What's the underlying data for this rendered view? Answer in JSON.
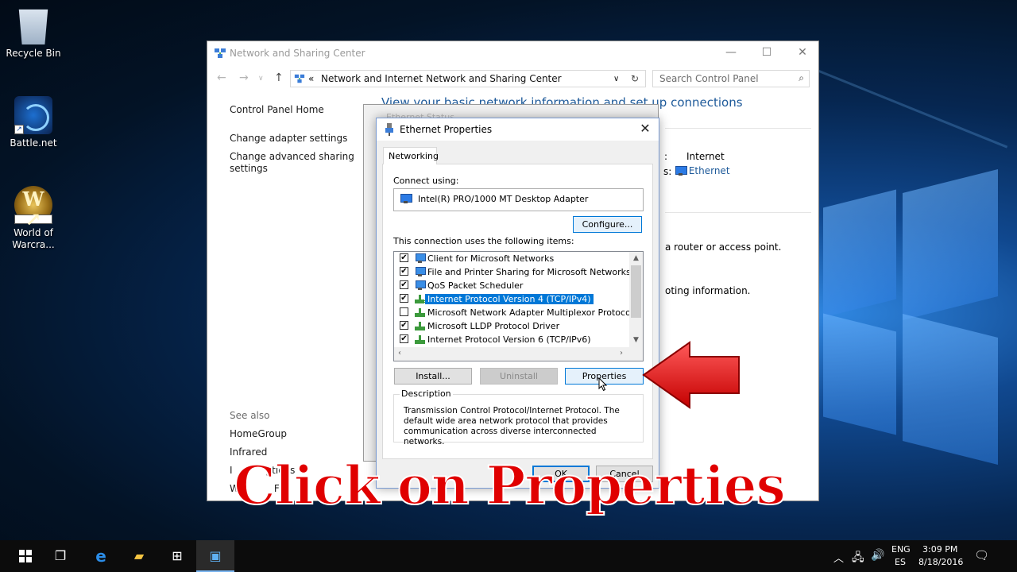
{
  "desktop": {
    "icons": [
      {
        "label": "Recycle Bin",
        "icon": "recycle-bin-icon"
      },
      {
        "label": "Battle.net",
        "icon": "battlenet-icon"
      },
      {
        "label": "World of Warcra...",
        "icon": "world-of-warcraft-icon",
        "line1": "World of",
        "line2": "Warcra..."
      }
    ]
  },
  "nsc": {
    "title": "Network and Sharing Center",
    "breadcrumb": {
      "prefix": "«",
      "items": [
        "Network and Internet",
        "Network and Sharing Center"
      ]
    },
    "search_placeholder": "Search Control Panel",
    "heading": "View your basic network information and set up connections",
    "left_links": {
      "home": "Control Panel Home",
      "adapter": "Change adapter settings",
      "advanced_line1": "Change advanced sharing",
      "advanced_line2": "settings",
      "see_also": "See also",
      "homegroup": "HomeGroup",
      "infrared": "Infrared",
      "internet_options_partial": "I",
      "internet_options_end": "ptions",
      "windows_firewall_partial": "W",
      "windows_firewall_end": "Fi"
    },
    "right": {
      "access_value": "Internet",
      "connections_label_tail": "s:",
      "connection_link": "Ethernet",
      "router_text": "a router or access point.",
      "troubleshoot_text": "oting information."
    }
  },
  "ethernet_status": {
    "title": "Ethernet Status"
  },
  "dialog": {
    "title": "Ethernet Properties",
    "tab": "Networking",
    "connect_using_label": "Connect using:",
    "adapter": "Intel(R) PRO/1000 MT Desktop Adapter",
    "configure": "Configure...",
    "items_label": "This connection uses the following items:",
    "items": [
      {
        "label": "Client for Microsoft Networks",
        "checked": true,
        "icon": "client-icon"
      },
      {
        "label": "File and Printer Sharing for Microsoft Networks",
        "checked": true,
        "icon": "service-icon"
      },
      {
        "label": "QoS Packet Scheduler",
        "checked": true,
        "icon": "service-icon"
      },
      {
        "label": "Internet Protocol Version 4 (TCP/IPv4)",
        "checked": true,
        "icon": "protocol-icon",
        "selected": true
      },
      {
        "label": "Microsoft Network Adapter Multiplexor Protocol",
        "checked": false,
        "icon": "protocol-icon"
      },
      {
        "label": "Microsoft LLDP Protocol Driver",
        "checked": true,
        "icon": "protocol-icon"
      },
      {
        "label": "Internet Protocol Version 6 (TCP/IPv6)",
        "checked": true,
        "icon": "protocol-icon"
      }
    ],
    "install": "Install...",
    "uninstall": "Uninstall",
    "properties": "Properties",
    "description_label": "Description",
    "description": "Transmission Control Protocol/Internet Protocol. The default wide area network protocol that provides communication across diverse interconnected networks.",
    "ok": "OK",
    "cancel": "Cancel"
  },
  "caption": "Click on Properties",
  "taskbar": {
    "lang_line1": "ENG",
    "lang_line2": "ES",
    "time": "3:09 PM",
    "date": "8/18/2016"
  },
  "colors": {
    "accent": "#0078d7",
    "caption_red": "#e00000",
    "arrow_red": "#e01b1b",
    "link_blue": "#1e5a9a"
  }
}
